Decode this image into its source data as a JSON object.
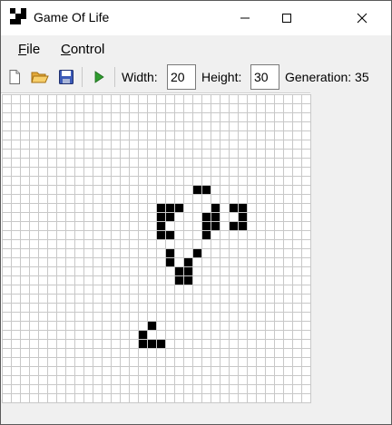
{
  "window": {
    "title": "Game Of Life",
    "controls": {
      "minimize": "minimize-icon",
      "maximize": "maximize-icon",
      "close": "close-icon"
    }
  },
  "menu": {
    "file_prefix": "F",
    "file_rest": "ile",
    "control_prefix": "C",
    "control_rest": "ontrol"
  },
  "toolbar": {
    "icons": [
      "new-file-icon",
      "open-folder-icon",
      "save-icon",
      "play-icon"
    ],
    "width_label": "Width:",
    "width_value": "20",
    "height_label": "Height:",
    "height_value": "30",
    "generation_label": "Generation: 35"
  },
  "board": {
    "columns": 34,
    "rows": 34,
    "alive_color": "#000000",
    "grid_color": "#c8c8c8",
    "alive_cells": [
      [
        21,
        10
      ],
      [
        22,
        10
      ],
      [
        17,
        12
      ],
      [
        18,
        12
      ],
      [
        19,
        12
      ],
      [
        23,
        12
      ],
      [
        25,
        12
      ],
      [
        26,
        12
      ],
      [
        17,
        13
      ],
      [
        18,
        13
      ],
      [
        22,
        13
      ],
      [
        23,
        13
      ],
      [
        26,
        13
      ],
      [
        17,
        14
      ],
      [
        22,
        14
      ],
      [
        23,
        14
      ],
      [
        25,
        14
      ],
      [
        26,
        14
      ],
      [
        17,
        15
      ],
      [
        18,
        15
      ],
      [
        22,
        15
      ],
      [
        18,
        17
      ],
      [
        21,
        17
      ],
      [
        18,
        18
      ],
      [
        20,
        18
      ],
      [
        19,
        19
      ],
      [
        20,
        19
      ],
      [
        19,
        20
      ],
      [
        20,
        20
      ],
      [
        16,
        25
      ],
      [
        15,
        26
      ],
      [
        15,
        27
      ],
      [
        16,
        27
      ],
      [
        17,
        27
      ]
    ]
  }
}
